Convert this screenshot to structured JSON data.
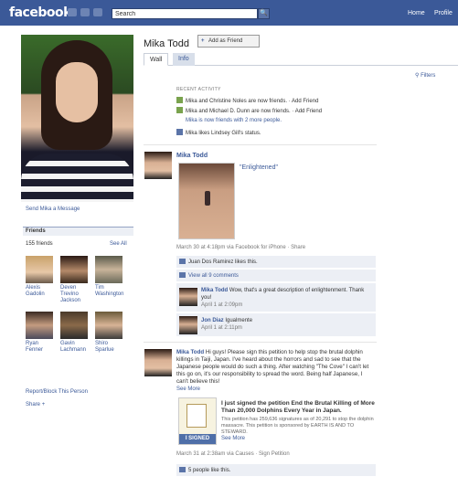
{
  "topbar": {
    "logo": "facebook",
    "search_value": "Search",
    "search_button": "🔍",
    "nav": [
      "Home",
      "Profile"
    ]
  },
  "profile": {
    "name": "Mika Todd",
    "add_friend": "Add as Friend",
    "send_message": "Send Mika a Message",
    "tabs": [
      "Wall",
      "Info"
    ],
    "filters": "Filters"
  },
  "friends": {
    "title": "Friends",
    "count": "155 friends",
    "see_all": "See All",
    "list": [
      {
        "name": "Alexis Gadolin"
      },
      {
        "name": "Deven Trevino Jackson"
      },
      {
        "name": "Tim Washington"
      },
      {
        "name": "Ryan Fenner"
      },
      {
        "name": "Gavin Lachmann"
      },
      {
        "name": "Shiro Sparlue"
      }
    ]
  },
  "sidebar": {
    "report": "Report/Block This Person",
    "share": "Share"
  },
  "activity": {
    "title": "RECENT ACTIVITY",
    "items": [
      "Mika and Christine Noles are now friends. · Add Friend",
      "Mika and Michael D. Dunn are now friends. · Add Friend",
      "Mika is now friends with 2 more people.",
      "Mika likes Lindsey Gill's status."
    ]
  },
  "post1": {
    "author": "Mika Todd",
    "caption": "\"Enlightened\"",
    "meta": "March 30 at 4:18pm via Facebook for iPhone · Share",
    "likes": "Juan Dos Ramirez likes this.",
    "view_comments": "View all 9 comments",
    "comments": [
      {
        "author": "Mika Todd",
        "text": "Wow, that's a great description of enlightenment. Thank you!",
        "time": "April 1 at 2:09pm"
      },
      {
        "author": "Jon Diaz",
        "text": "Igualmente",
        "time": "April 1 at 2:11pm"
      }
    ]
  },
  "post2": {
    "author": "Mika Todd",
    "text": "Hi guys! Please sign this petition to help stop the brutal dolphin killings in Taiji, Japan. I've heard about the horrors and sad to see that the Japanese people would do such a thing. After watching \"The Cove\" I can't let this go on, it's our responsibility to spread the word. Being half Japanese, I can't believe this!",
    "see_more": "See More",
    "petition_title": "I just signed the petition End the Brutal Killing of More Than 20,000 Dolphins Every Year in Japan.",
    "petition_desc": "This petition has 259,636 signatures as of 20,291 to stop the dolphin massacre. This petition is sponsored by EARTH IS AND TO STEWARD.",
    "petition_see_more": "See More",
    "petition_badge": "I SIGNED",
    "meta": "March 31 at 2:38am via Causes · Sign Petition",
    "likes": "5 people like this."
  }
}
